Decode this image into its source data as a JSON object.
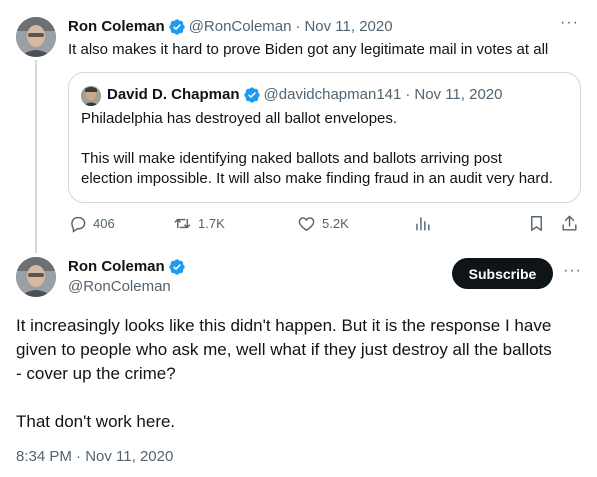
{
  "parent_tweet": {
    "author_name": "Ron Coleman",
    "handle": "@RonColeman",
    "separator": "·",
    "date": "Nov 11, 2020",
    "more_label": "···",
    "text": "It also makes it hard to prove Biden got any legitimate mail in votes at all",
    "quoted_tweet": {
      "author_name": "David D. Chapman",
      "handle": "@davidchapman141",
      "separator": "·",
      "date": "Nov 11, 2020",
      "lines": [
        "Philadelphia has destroyed all ballot envelopes.",
        "This will make identifying naked ballots and ballots arriving post",
        "election impossible. It will also make finding fraud in an audit very hard."
      ]
    },
    "actions": {
      "replies": "406",
      "reposts": "1.7K",
      "likes": "5.2K"
    }
  },
  "main_tweet": {
    "author_name": "Ron Coleman",
    "handle": "@RonColeman",
    "subscribe_label": "Subscribe",
    "more_label": "···",
    "lines": [
      "It increasingly looks like this didn't happen. But it is the response I have",
      "given to people who ask me, well what if they just destroy all the ballots",
      "- cover up the crime?",
      "That don't work here."
    ],
    "timestamp": "8:34 PM · Nov 11, 2020"
  },
  "icons": [
    "verified-badge-icon",
    "reply-icon",
    "repost-icon",
    "like-icon",
    "views-icon",
    "bookmark-icon",
    "share-icon"
  ],
  "colors": {
    "verified": "#1d9bf0",
    "muted": "#536471",
    "text": "#0f1419",
    "border": "#cfd9de",
    "subscribe_bg": "#0f1419"
  }
}
